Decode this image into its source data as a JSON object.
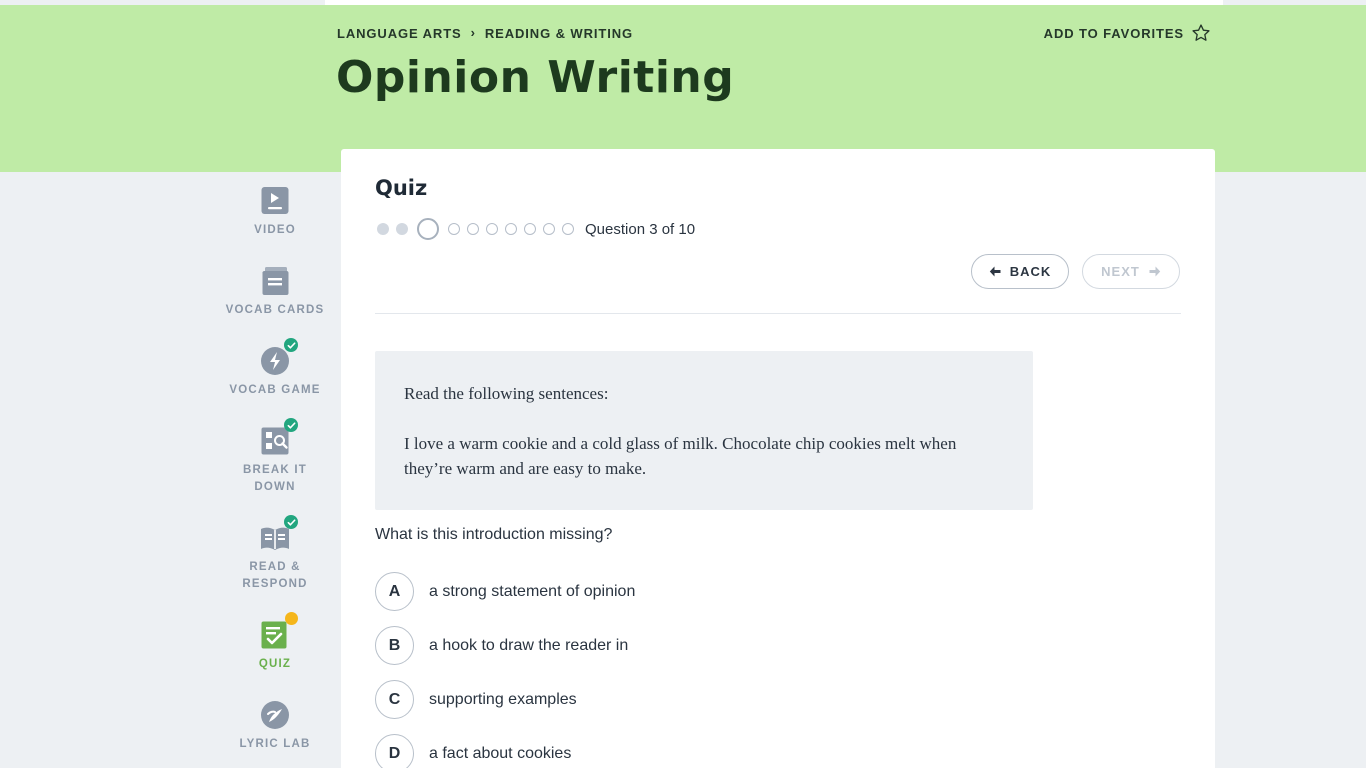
{
  "breadcrumb": {
    "parent": "LANGUAGE ARTS",
    "child": "READING & WRITING"
  },
  "favorites_label": "ADD TO FAVORITES",
  "page_title": "Opinion Writing",
  "sidebar": {
    "items": [
      {
        "label": "VIDEO",
        "icon": "video-icon",
        "status": "none"
      },
      {
        "label": "VOCAB CARDS",
        "icon": "vocab-cards-icon",
        "status": "none"
      },
      {
        "label": "VOCAB GAME",
        "icon": "lightning-icon",
        "status": "complete"
      },
      {
        "label_line1": "BREAK IT",
        "label_line2": "DOWN",
        "icon": "magnify-grid-icon",
        "status": "complete"
      },
      {
        "label_line1": "READ &",
        "label_line2": "RESPOND",
        "icon": "book-icon",
        "status": "complete"
      },
      {
        "label": "QUIZ",
        "icon": "quiz-icon",
        "status": "in-progress",
        "active": true
      },
      {
        "label": "LYRIC LAB",
        "icon": "lyric-lab-icon",
        "status": "none"
      }
    ]
  },
  "quiz": {
    "title": "Quiz",
    "current_question": 3,
    "total_questions": 10,
    "counter_label": "Question 3 of 10",
    "back_label": "BACK",
    "next_label": "NEXT",
    "next_enabled": false
  },
  "passage": {
    "intro": "Read the following sentences:",
    "body": "I love a warm cookie and a cold glass of milk. Chocolate chip cookies melt when they’re warm and are easy to make."
  },
  "question_text": "What is this introduction missing?",
  "answers": [
    {
      "letter": "A",
      "text": "a strong statement of opinion"
    },
    {
      "letter": "B",
      "text": "a hook to draw the reader in"
    },
    {
      "letter": "C",
      "text": "supporting examples"
    },
    {
      "letter": "D",
      "text": "a fact about cookies"
    }
  ],
  "colors": {
    "banner": "#bfeba6",
    "title": "#1d3a1e",
    "active_nav": "#6ab04c",
    "complete_badge": "#22a67f",
    "in_progress_badge": "#f5b61b",
    "background": "#edf0f3"
  }
}
